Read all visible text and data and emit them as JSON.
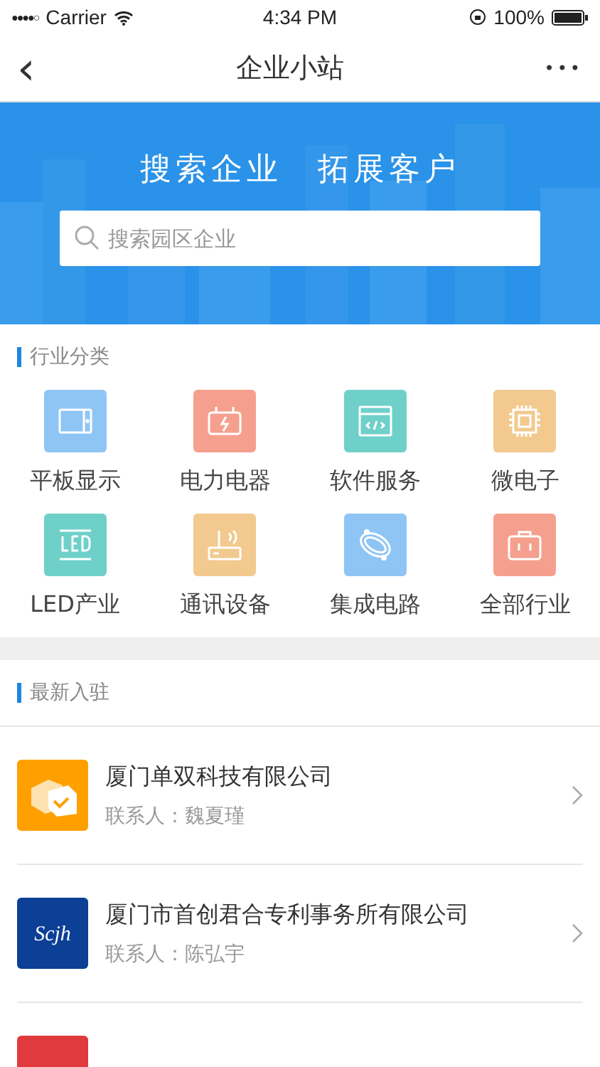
{
  "status_bar": {
    "signal": "●●●●○",
    "carrier": "Carrier",
    "time": "4:34 PM",
    "battery": "100%"
  },
  "nav": {
    "back": "‹",
    "title": "企业小站",
    "more": "•••"
  },
  "banner": {
    "slogan": "搜索企业　拓展客户",
    "search": {
      "placeholder": "搜索园区企业"
    }
  },
  "categories": {
    "title": "行业分类",
    "items": [
      {
        "label": "平板显示",
        "kind": "tablet",
        "color": "#8ec5f5"
      },
      {
        "label": "电力电器",
        "kind": "power",
        "color": "#f5a08e"
      },
      {
        "label": "软件服务",
        "kind": "code",
        "color": "#6fd0c9"
      },
      {
        "label": "微电子",
        "kind": "chip",
        "color": "#f2c98e"
      },
      {
        "label": "LED产业",
        "kind": "led",
        "color": "#6fd0c9"
      },
      {
        "label": "通讯设备",
        "kind": "router",
        "color": "#f2c98e"
      },
      {
        "label": "集成电路",
        "kind": "ring",
        "color": "#8ec5f5"
      },
      {
        "label": "全部行业",
        "kind": "bag",
        "color": "#f5a08e"
      }
    ]
  },
  "latest": {
    "title": "最新入驻",
    "companies": [
      {
        "name": "厦门单双科技有限公司",
        "contact": "联系人：魏夏瑾",
        "kind": "box",
        "color": "#ffa000"
      },
      {
        "name": "厦门市首创君合专利事务所有限公司",
        "contact": "联系人：陈弘宇",
        "kind": "script",
        "logo_text": "Scjh",
        "color": "#0c3f96"
      },
      {
        "kind": "blank",
        "color": "#e0393e"
      }
    ]
  }
}
